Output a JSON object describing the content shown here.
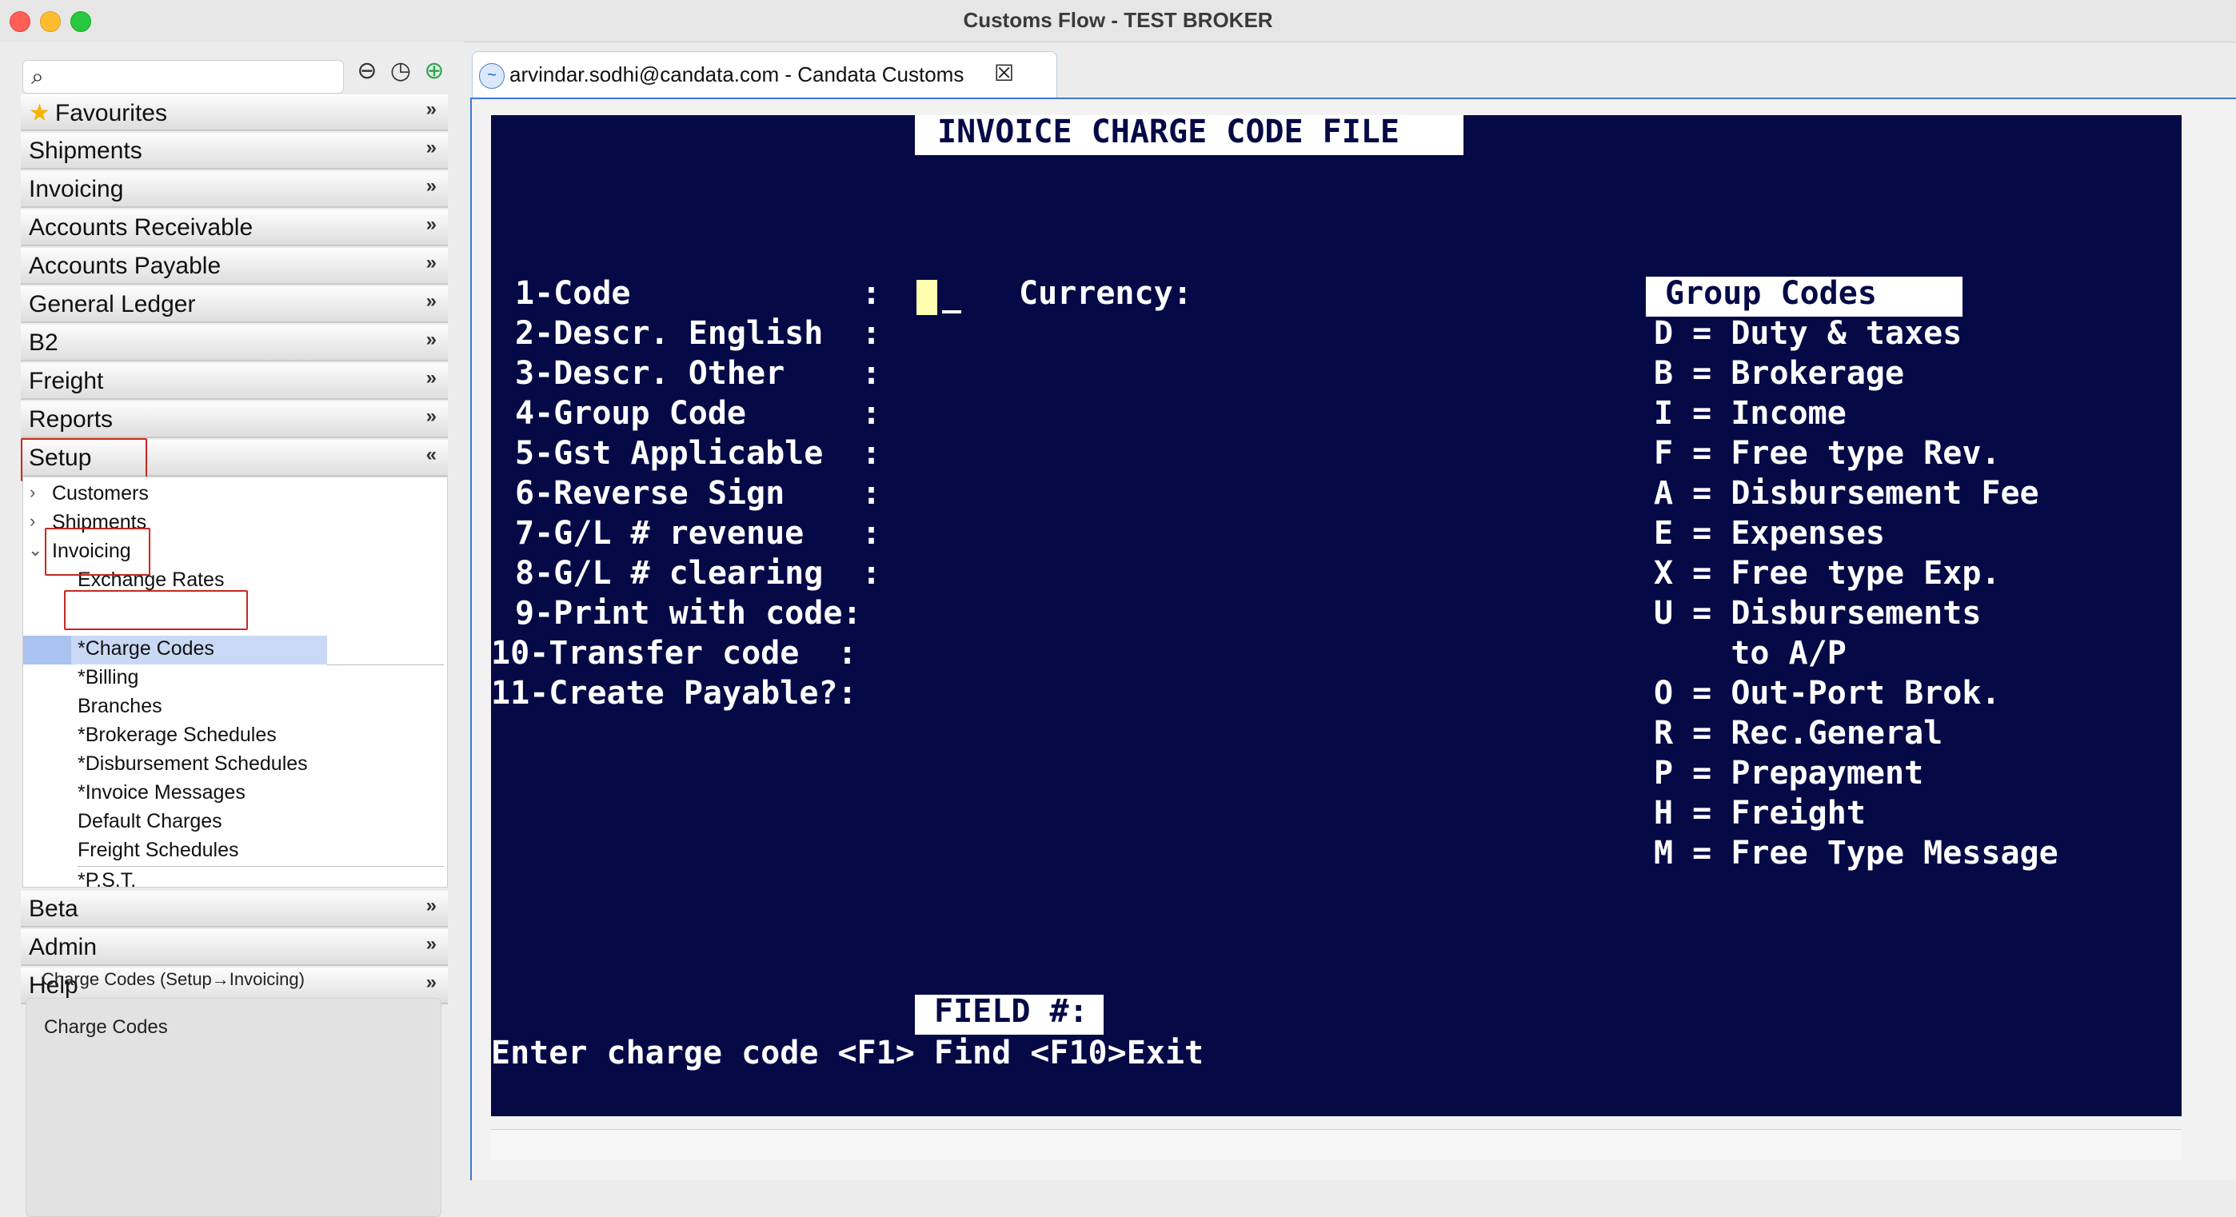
{
  "window": {
    "title": "Customs Flow - TEST BROKER"
  },
  "sidebar": {
    "search": {
      "value": "",
      "placeholder": ""
    },
    "toolbar_icons": [
      "back-icon",
      "history-icon",
      "add-icon"
    ],
    "categories": [
      {
        "label": "Favourites"
      },
      {
        "label": "Shipments"
      },
      {
        "label": "Invoicing"
      },
      {
        "label": "Accounts Receivable"
      },
      {
        "label": "Accounts Payable"
      },
      {
        "label": "General Ledger"
      },
      {
        "label": "B2"
      },
      {
        "label": "Freight"
      },
      {
        "label": "Reports"
      },
      {
        "label": "Setup"
      }
    ],
    "bottom_categories": [
      {
        "label": "Beta"
      },
      {
        "label": "Admin"
      },
      {
        "label": "Help"
      }
    ],
    "tree": {
      "items": [
        {
          "label": "Customers"
        },
        {
          "label": "Shipments"
        },
        {
          "label": "Invoicing"
        },
        {
          "label": "Exchange Rates"
        },
        {
          "label": "*Charge Codes"
        },
        {
          "label": "*Billing"
        },
        {
          "label": "Branches"
        },
        {
          "label": "*Brokerage Schedules"
        },
        {
          "label": "*Disbursement Schedules"
        },
        {
          "label": "*Invoice Messages"
        },
        {
          "label": "Default Charges"
        },
        {
          "label": "Freight Schedules"
        },
        {
          "label": "*P.S.T."
        }
      ]
    },
    "status_path": "Charge Codes (Setup→Invoicing)",
    "description": "Charge Codes"
  },
  "tab": {
    "label": "arvindar.sodhi@candata.com - Candata Customs",
    "close": "☒"
  },
  "terminal": {
    "title": "INVOICE CHARGE CODE FILE",
    "currency_label": "Currency:",
    "fields": [
      "1-Code            :",
      "2-Descr. English  :",
      "3-Descr. Other    :",
      "4-Group Code      :",
      "5-Gst Applicable  :",
      "6-Reverse Sign    :",
      "7-G/L # revenue   :",
      "8-G/L # clearing  :",
      "9-Print with code:",
      "10-Transfer code  :",
      "11-Create Payable?:"
    ],
    "group_codes_title": "Group Codes",
    "group_codes": [
      "D = Duty & taxes",
      "B = Brokerage",
      "I = Income",
      "F = Free type Rev.",
      "A = Disbursement Fee",
      "E = Expenses",
      "X = Free type Exp.",
      "U = Disbursements",
      "    to A/P",
      "O = Out-Port Brok.",
      "R = Rec.General",
      "P = Prepayment",
      "H = Freight",
      "M = Free Type Message"
    ],
    "field_prompt": "FIELD #:",
    "help_line": "Enter charge code <F1> Find <F10>Exit"
  },
  "colors": {
    "terminal_bg": "#050a47",
    "terminal_fg": "#ffffff",
    "cursor": "#ffffb0",
    "selection": "#c9d9f5",
    "annotation_red": "#c8281e"
  }
}
